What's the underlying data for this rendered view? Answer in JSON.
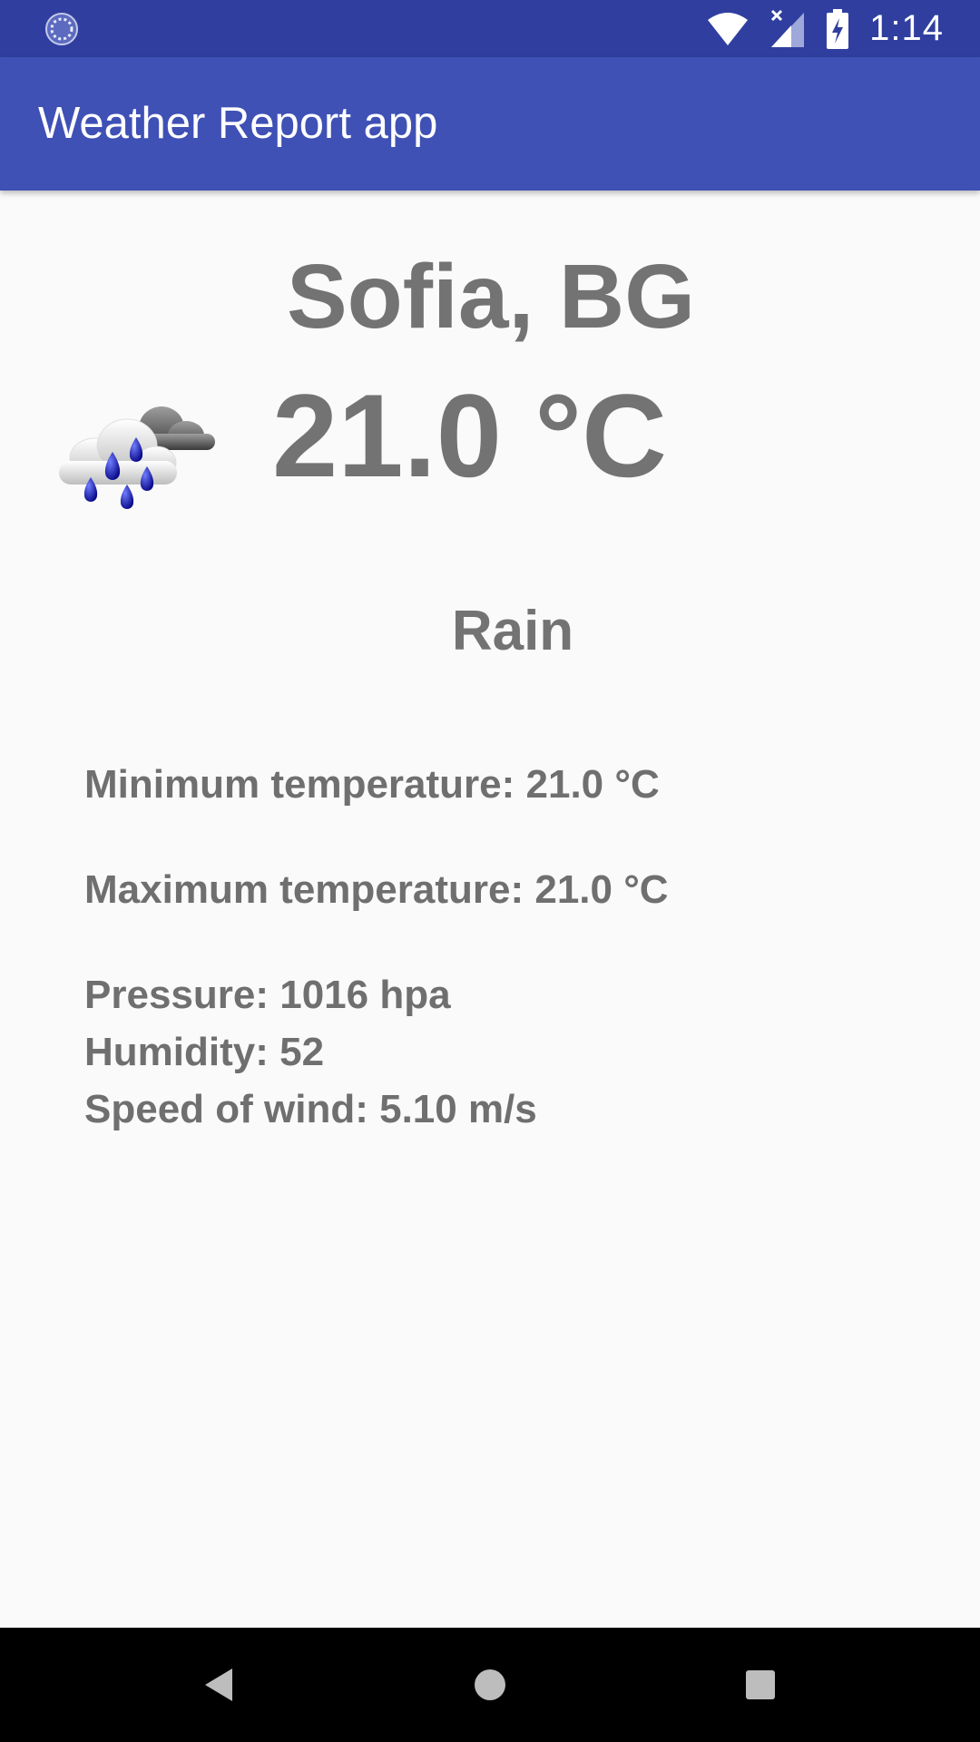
{
  "status_bar": {
    "time": "1:14",
    "icons": [
      "sync-icon",
      "wifi-icon",
      "cellular-no-data-icon",
      "battery-charging-icon"
    ]
  },
  "app_bar": {
    "title": "Weather Report app"
  },
  "weather": {
    "city": "Sofia, BG",
    "temperature": "21.0 °C",
    "condition": "Rain",
    "icon": "rain-cloud-icon",
    "min_temperature": "Minimum temperature: 21.0 °C",
    "max_temperature": "Maximum temperature: 21.0 °C",
    "pressure": "Pressure: 1016 hpa",
    "humidity": "Humidity: 52",
    "wind_speed": "Speed of wind: 5.10 m/s"
  },
  "nav_bar": {
    "buttons": [
      "back-icon",
      "home-icon",
      "recents-icon"
    ]
  },
  "colors": {
    "status_bar": "#303f9f",
    "app_bar": "#3f51b5",
    "text": "#737373",
    "background": "#fafafa"
  }
}
